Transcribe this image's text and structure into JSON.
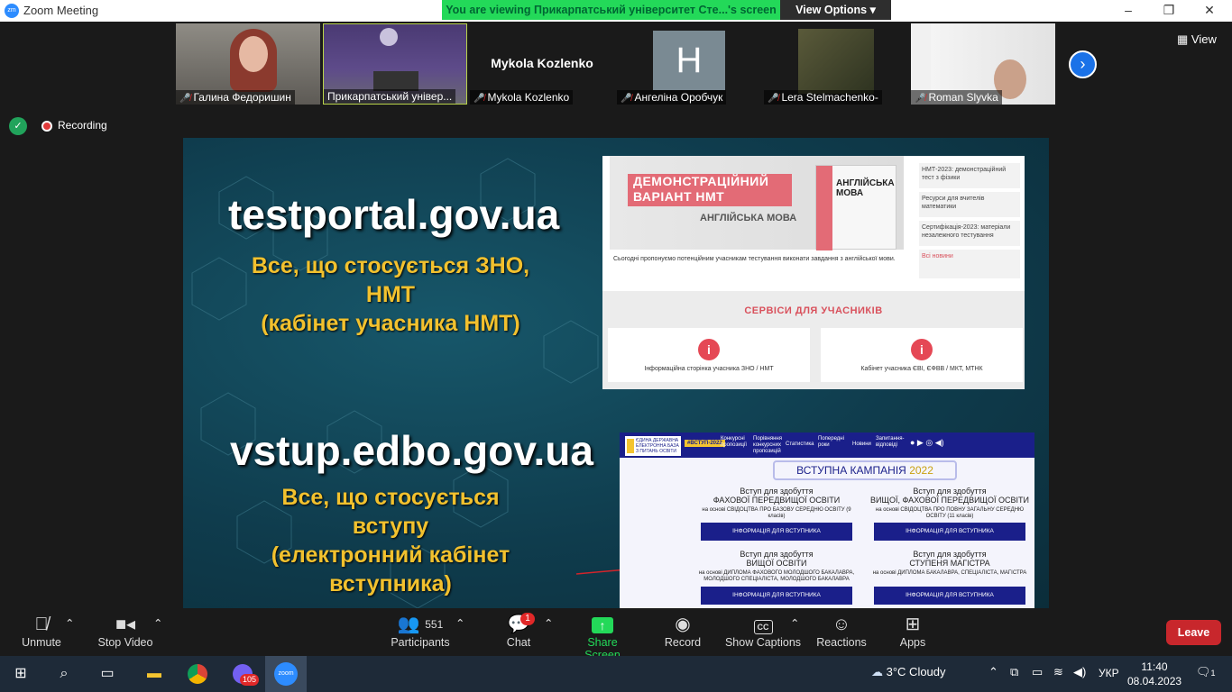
{
  "window": {
    "title": "Zoom Meeting",
    "app_icon": "zoom",
    "minimize": "–",
    "maximize": "❐",
    "close": "✕"
  },
  "share_banner": {
    "viewing_text": "You are viewing Прикарпатський університет Сте...'s screen",
    "view_options": "View Options",
    "view_options_chevron": "▾"
  },
  "gallery": {
    "view_label": "View",
    "participants": [
      {
        "name": "Галина Федоришин",
        "muted": true
      },
      {
        "name": "Прикарпатський універ...",
        "muted": false,
        "active_speaker": true
      },
      {
        "name": "Mykola Kozlenko",
        "muted": true,
        "display_text": "Mykola Kozlenko"
      },
      {
        "name": "Ангеліна Оробчук",
        "muted": true,
        "avatar_letter": "H"
      },
      {
        "name": "Lera Stelmachenko-",
        "muted": true
      },
      {
        "name": "Roman Slyvka",
        "muted": true
      }
    ]
  },
  "status": {
    "recording": "Recording"
  },
  "slide": {
    "heading1": "testportal.gov.ua",
    "sub1": [
      "Все, що стосується ЗНО,",
      "НМТ",
      "(кабінет учасника НМТ)"
    ],
    "heading2": "vstup.edbo.gov.ua",
    "sub2": [
      "Все, що стосується",
      "вступу",
      "(електронний кабінет",
      "вступника)"
    ],
    "testportal": {
      "demo": [
        "ДЕМОНСТРАЦІЙНИЙ",
        "ВАРІАНТ НМТ"
      ],
      "subject": "АНГЛІЙСЬКА МОВА",
      "book_title": [
        "АНГЛІЙСЬКА",
        "МОВА"
      ],
      "news": [
        "НМТ-2023: демонстраційний тест з фізики",
        "Ресурси для вчителів математики",
        "Сертифікація-2023: матеріали незалежного тестування",
        "Всі новини"
      ],
      "description": "Сьогодні пропонуємо потенційним учасникам тестування виконати завдання з англійської мови.",
      "services_title": "СЕРВІСИ ДЛЯ УЧАСНИКІВ",
      "cards": [
        "Інформаційна сторінка учасника ЗНО / НМТ",
        "Кабінет учасника ЄВІ, ЄФВВ / МКТ, МТНК"
      ]
    },
    "vstup": {
      "logo": "ЄДИНА ДЕРЖАВНА ЕЛЕКТРОННА БАЗА З ПИТАНЬ ОСВІТИ",
      "nav_tag": "#ВСТУП-2022",
      "nav": [
        "Конкурсні пропозиції",
        "Порівняння конкурсних пропозицій",
        "Статистика",
        "Попередні роки",
        "Новини",
        "Запитання-відповіді"
      ],
      "campaign": "ВСТУПНА КАМПАНІЯ",
      "year": "2022",
      "blocks": [
        {
          "t1": "Вступ для здобуття",
          "t2": "ФАХОВОЇ ПЕРЕДВИЩОЇ ОСВІТИ",
          "t3": "на основі СВІДОЦТВА ПРО БАЗОВУ СЕРЕДНЮ ОСВІТУ (9 класів)"
        },
        {
          "t1": "Вступ для здобуття",
          "t2": "ВИЩОЇ, ФАХОВОЇ ПЕРЕДВИЩОЇ ОСВІТИ",
          "t3": "на основі СВІДОЦТВА ПРО ПОВНУ ЗАГАЛЬНУ СЕРЕДНЮ ОСВІТУ (11 класів)"
        },
        {
          "t1": "Вступ для здобуття",
          "t2": "ВИЩОЇ ОСВІТИ",
          "t3": "на основі ДИПЛОМА ФАХОВОГО МОЛОДШОГО БАКАЛАВРА, МОЛОДШОГО СПЕЦІАЛІСТА, МОЛОДШОГО БАКАЛАВРА"
        },
        {
          "t1": "Вступ для здобуття",
          "t2": "СТУПЕНЯ МАГІСТРА",
          "t3": "на основі ДИПЛОМА БАКАЛАВРА, СПЕЦІАЛІСТА, МАГІСТРА"
        }
      ],
      "info_button": "ІНФОРМАЦІЯ ДЛЯ ВСТУПНИКА"
    }
  },
  "toolbar": {
    "unmute": "Unmute",
    "stop_video": "Stop Video",
    "participants_count": "551",
    "participants": "Participants",
    "chat_badge": "1",
    "chat": "Chat",
    "share_screen": "Share Screen",
    "record": "Record",
    "show_captions": "Show Captions",
    "cc": "CC",
    "reactions": "Reactions",
    "apps": "Apps",
    "leave": "Leave"
  },
  "taskbar": {
    "viber_badge": "105",
    "zoom_label": "zoom",
    "weather": "3°C  Cloudy",
    "lang": "УКР",
    "time": "11:40",
    "date": "08.04.2023",
    "notif_badge": "1"
  },
  "colors": {
    "share_green": "#23d959",
    "leave_red": "#c8272c",
    "zoom_blue": "#2d8cff",
    "slide_yellow": "#f2c12e",
    "vstup_navy": "#1a1f8a"
  }
}
